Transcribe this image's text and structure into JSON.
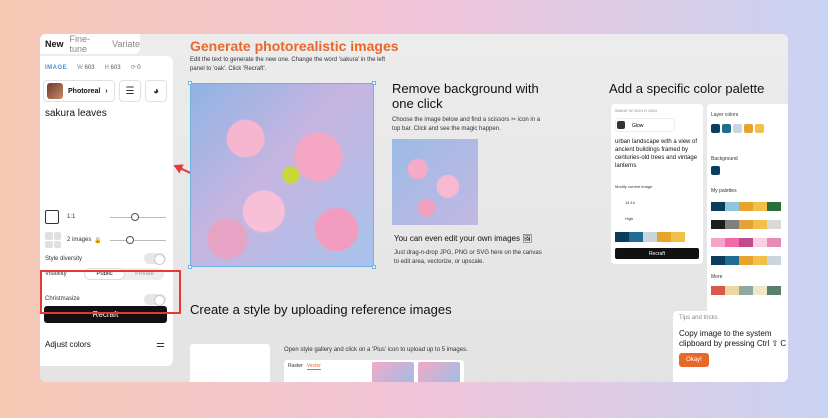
{
  "left_panel": {
    "tabs": [
      "New",
      "Fine-tune",
      "Variate"
    ],
    "active_tab": "New",
    "image_label": "IMAGE",
    "width_label": "W",
    "width_value": "603",
    "height_label": "H",
    "height_value": "603",
    "seed_value": "0",
    "style_name": "Photoreal",
    "style_chevron": "›",
    "prompt": "sakura leaves",
    "ratio_label": "1:1",
    "images_count_label": "2 images",
    "style_diversity_label": "Style diversity",
    "visibility_label": "Visibility",
    "visibility_options": [
      "Public",
      "Private"
    ],
    "visibility_selected": "Public",
    "christmasize_label": "Christmasize",
    "recraft_label": "Recraft",
    "adjust_colors_label": "Adjust colors"
  },
  "section_generate": {
    "title": "Generate photorealistic images",
    "description": "Edit the text to generate the new one. Change the word 'sakura' in the left panel to 'oak'. Click 'Recraft'."
  },
  "section_remove_bg": {
    "title": "Remove background with one click",
    "description": "Choose the image below and find a scissors ✂ icon in a top bar. Click and see the magic happen.",
    "edit_title": "You can even edit your own images",
    "edit_description": "Just drag-n-drop JPG, PNG or SVG here on the canvas to edit area, vectorize, or upscale."
  },
  "section_palette": {
    "title": "Add a specific color palette",
    "mini_panel": {
      "image_label": "IMAGE",
      "w": "1024",
      "h": "1024",
      "style_name": "Glow",
      "prompt": "urban landscape with a view of ancient buildings framed by centuries-old trees and vintage lanterns",
      "modify_label": "Modify current image",
      "ratio_label": "14:10",
      "quality_label": "High",
      "button_label": "Recraft",
      "swatches": [
        "#0b3d5c",
        "#1e6e94",
        "#c9d6de",
        "#e9a32a",
        "#f1c04b"
      ]
    },
    "palette_panel": {
      "layer_colors_label": "Layer colors",
      "layer_colors": [
        "#0b3d5c",
        "#1e6e94",
        "#c9d6de",
        "#e9a32a",
        "#f1c04b"
      ],
      "background_label": "Background",
      "background_color": "#0b3d5c",
      "my_palettes_label": "My palettes",
      "palettes": [
        [
          "#0b3d5c",
          "#8fc6de",
          "#e9a32a",
          "#f1c04b",
          "#2a6f3a"
        ],
        [
          "#1d1d1d",
          "#7f7f7f",
          "#e3a13a",
          "#f1c04b",
          "#d9d9d9"
        ],
        [
          "#f6a3c8",
          "#f06aa8",
          "#c04a8a",
          "#f9d0e0",
          "#e88ab8"
        ],
        [
          "#0b3d5c",
          "#1e6e94",
          "#e9a32a",
          "#f1c04b",
          "#c9d6de"
        ]
      ],
      "more_label": "More"
    }
  },
  "section_style": {
    "title": "Create a style by uploading reference images",
    "description": "Open style gallery and click on a 'Plus' icon to upload up to 5 images.",
    "gallery_tabs": [
      "Raster",
      "Vector"
    ],
    "gallery_active": "Vector"
  },
  "tips": {
    "header": "Tips and tricks",
    "body": "Copy image to the system clipboard by pressing Ctrl ⇧ C",
    "button": "Okay!"
  }
}
